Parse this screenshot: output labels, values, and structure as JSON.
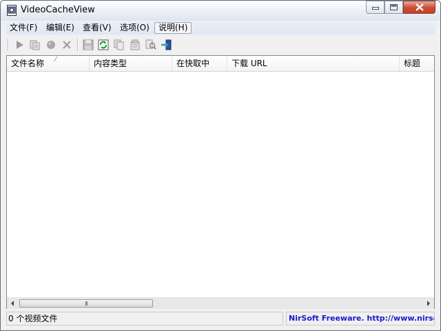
{
  "window": {
    "title": "VideoCacheView"
  },
  "menu": [
    {
      "label": "文件(F)"
    },
    {
      "label": "编辑(E)"
    },
    {
      "label": "查看(V)"
    },
    {
      "label": "选项(O)"
    },
    {
      "label": "说明(H)"
    }
  ],
  "toolbar": {
    "icons": [
      "play-icon",
      "copy-files-icon",
      "record-icon",
      "delete-icon",
      "save-icon",
      "refresh-icon",
      "copy-icon",
      "properties-icon",
      "find-icon",
      "exit-icon"
    ]
  },
  "list": {
    "columns": [
      {
        "label": "文件名称"
      },
      {
        "label": "内容类型"
      },
      {
        "label": "在快取中"
      },
      {
        "label": "下载 URL"
      },
      {
        "label": "标题"
      }
    ],
    "sort_indicator": "⁄",
    "rows": []
  },
  "scrollbar": {
    "grip": "III"
  },
  "status": {
    "left": "0 个视频文件",
    "right": "NirSoft Freeware.  http://www.nirsoft.net"
  }
}
